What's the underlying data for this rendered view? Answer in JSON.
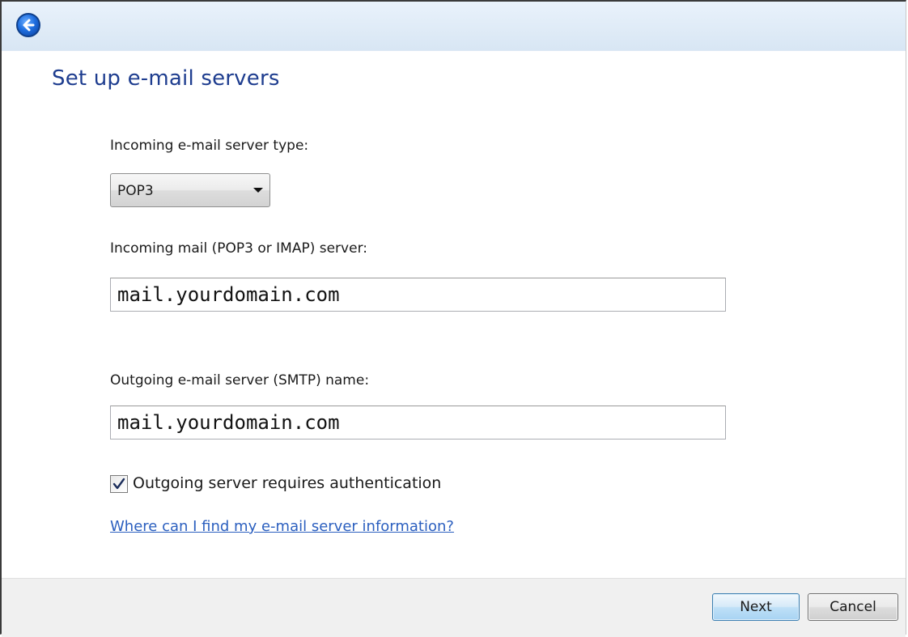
{
  "page": {
    "title": "Set up e-mail servers"
  },
  "incoming_type": {
    "label": "Incoming e-mail server type:",
    "selected": "POP3"
  },
  "incoming_server": {
    "label": "Incoming mail (POP3 or IMAP) server:",
    "value": "mail.yourdomain.com"
  },
  "outgoing_server": {
    "label": "Outgoing e-mail server (SMTP) name:",
    "value": "mail.yourdomain.com"
  },
  "auth_checkbox": {
    "label": "Outgoing server requires authentication",
    "checked": true
  },
  "help_link": {
    "text": "Where can I find my e-mail server information?"
  },
  "buttons": {
    "next": "Next",
    "cancel": "Cancel"
  },
  "icons": {
    "back": "back-arrow-icon",
    "dropdown": "chevron-down-icon",
    "check": "checkmark-icon"
  },
  "colors": {
    "title": "#1e3d8f",
    "link": "#2b5fbf",
    "titlebar": "#dce8f4",
    "footer": "#f0f0f0"
  }
}
